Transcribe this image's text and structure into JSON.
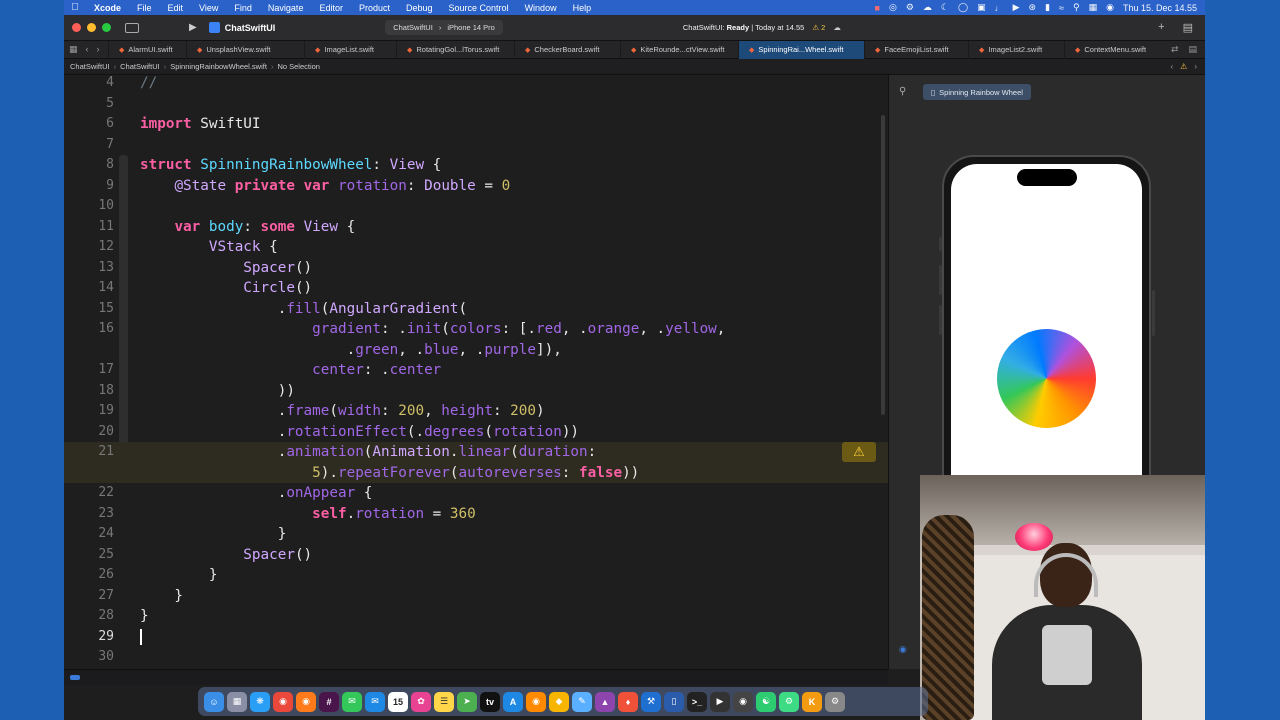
{
  "menubar": {
    "app_name": "Xcode",
    "items": [
      "File",
      "Edit",
      "View",
      "Find",
      "Navigate",
      "Editor",
      "Product",
      "Debug",
      "Source Control",
      "Window",
      "Help"
    ],
    "clock": "Thu 15. Dec  14.55"
  },
  "toolbar": {
    "project": "ChatSwiftUI",
    "scheme": "ChatSwiftUI",
    "device": "iPhone 14 Pro",
    "status_app": "ChatSwiftUI:",
    "status_state": "Ready",
    "status_time": "| Today at 14.55",
    "warning_count": "2"
  },
  "tabs": [
    {
      "label": "AlarmUI.swift",
      "active": false
    },
    {
      "label": "UnsplashView.swift",
      "active": false
    },
    {
      "label": "ImageList.swift",
      "active": false
    },
    {
      "label": "RotatingGol...lTorus.swift",
      "active": false
    },
    {
      "label": "CheckerBoard.swift",
      "active": false
    },
    {
      "label": "KiteRounde...ctView.swift",
      "active": false
    },
    {
      "label": "SpinningRai...Wheel.swift",
      "active": true
    },
    {
      "label": "FaceEmojiList.swift",
      "active": false
    },
    {
      "label": "ImageList2.swift",
      "active": false
    },
    {
      "label": "ContextMenu.swift",
      "active": false
    }
  ],
  "jumpbar": {
    "project": "ChatSwiftUI",
    "group": "ChatSwiftUI",
    "file": "SpinningRainbowWheel.swift",
    "selection": "No Selection"
  },
  "editor": {
    "line_numbers": [
      "4",
      "5",
      "6",
      "7",
      "8",
      "9",
      "10",
      "11",
      "12",
      "13",
      "14",
      "15",
      "16",
      "",
      "17",
      "18",
      "19",
      "20",
      "21",
      "",
      "22",
      "23",
      "24",
      "25",
      "26",
      "27",
      "28",
      "29",
      "30"
    ],
    "current_line": "29",
    "warning_line": "21"
  },
  "preview": {
    "chip_label": "Spinning Rainbow Wheel"
  },
  "colors": {
    "desktop": "#1d5fb3",
    "editor_bg": "#1e1e1e",
    "keyword": "#fc5fa3",
    "type": "#d0a8ff",
    "member": "#a167e6",
    "number": "#d0bf69",
    "active_tab": "#1e4a7a"
  },
  "dock": {
    "calendar_day": "15"
  }
}
